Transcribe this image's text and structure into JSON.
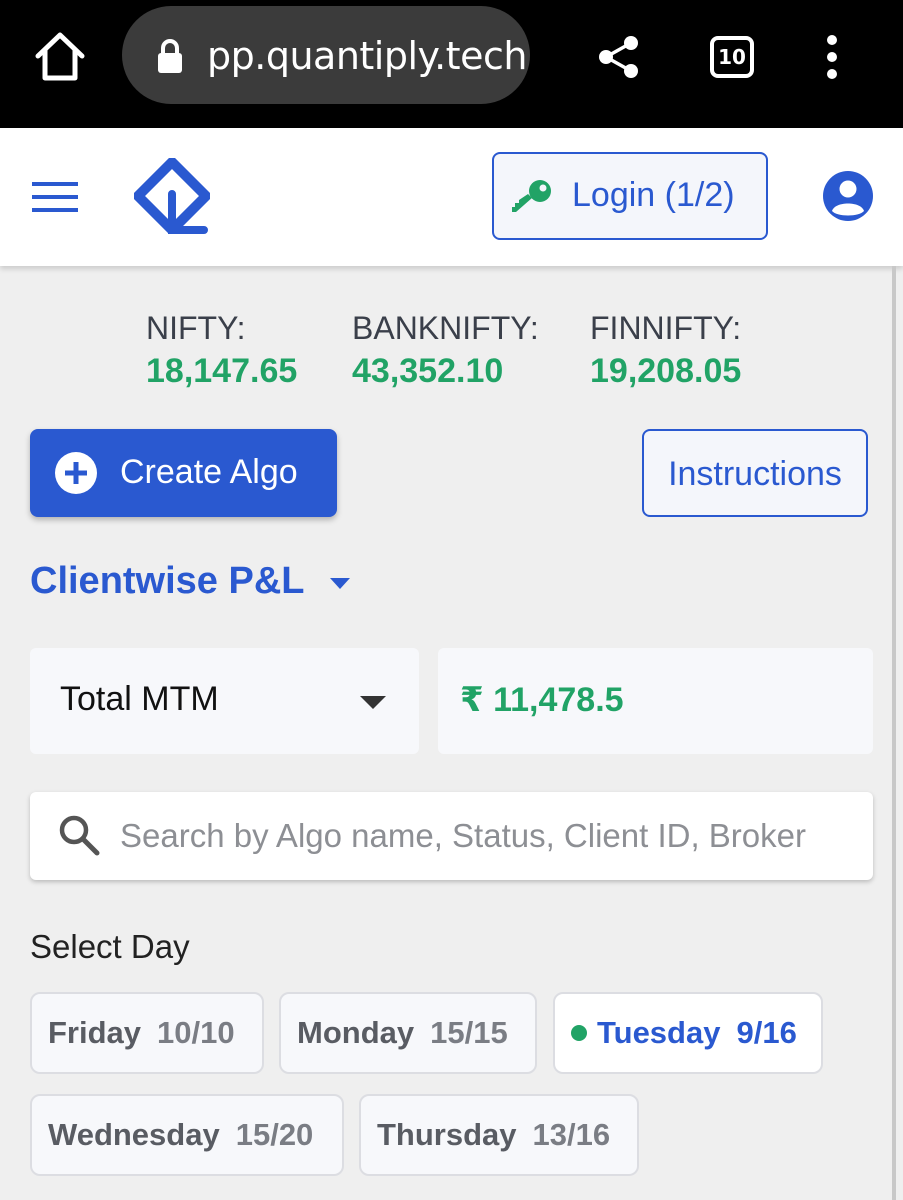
{
  "browser": {
    "url": "pp.quantiply.tech",
    "tab_count": "10"
  },
  "header": {
    "login_label": "Login (1/2)"
  },
  "indices": [
    {
      "name": "NIFTY:",
      "value": "18,147.65"
    },
    {
      "name": "BANKNIFTY:",
      "value": "43,352.10"
    },
    {
      "name": "FINNIFTY:",
      "value": "19,208.05"
    }
  ],
  "actions": {
    "create_algo_label": "Create Algo",
    "instructions_label": "Instructions"
  },
  "clientwise": {
    "title": "Clientwise P&L"
  },
  "mtm": {
    "selected": "Total MTM",
    "value": "₹ 11,478.5"
  },
  "search": {
    "placeholder": "Search by Algo name, Status, Client ID, Broker"
  },
  "select_day": {
    "label": "Select Day",
    "days": [
      {
        "day": "Friday",
        "count": "10/10",
        "active": false
      },
      {
        "day": "Monday",
        "count": "15/15",
        "active": false
      },
      {
        "day": "Tuesday",
        "count": "9/16",
        "active": true
      },
      {
        "day": "Wednesday",
        "count": "15/20",
        "active": false
      },
      {
        "day": "Thursday",
        "count": "13/16",
        "active": false
      }
    ]
  },
  "colors": {
    "brand_blue": "#2a59d0",
    "profit_green": "#21a366"
  },
  "icons": [
    "home-icon",
    "lock-icon",
    "share-icon",
    "tabs-icon",
    "more-vert-icon",
    "hamburger-icon",
    "logo-icon",
    "key-icon",
    "user-circle-icon",
    "plus-circle-icon",
    "caret-down-icon",
    "search-icon",
    "active-dot-icon"
  ]
}
